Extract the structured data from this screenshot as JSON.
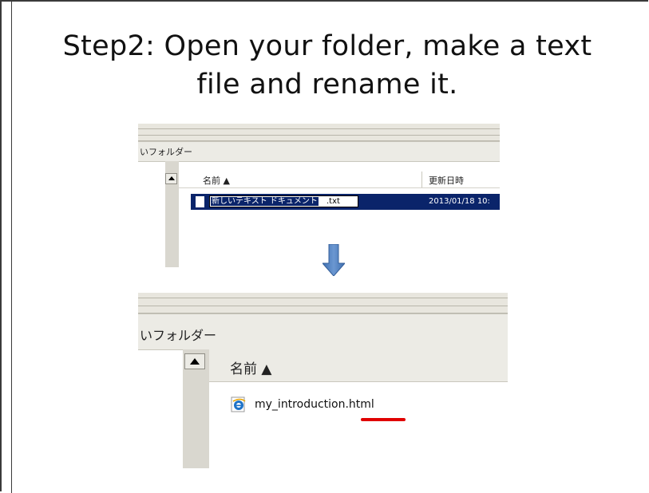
{
  "title": {
    "line1": "Step2: Open your folder, make a text",
    "line2": "file and rename it."
  },
  "screenshot_before": {
    "address_text": "いフォルダー",
    "column_name": "名前 ▲",
    "column_date": "更新日時",
    "rename_selected": "新しいテキスト ドキュメント",
    "rename_extension": ".txt",
    "date_value": "2013/01/18 10:"
  },
  "screenshot_after": {
    "address_text": "いフォルダー",
    "column_name": "名前 ▲",
    "file_name": "my_introduction.html"
  },
  "colors": {
    "selection": "#0a246a",
    "arrow": "#4f7fbf",
    "underline": "#e00000"
  },
  "icons": [
    "text-file-icon",
    "down-arrow-icon",
    "ie-file-icon",
    "scroll-up-icon"
  ]
}
